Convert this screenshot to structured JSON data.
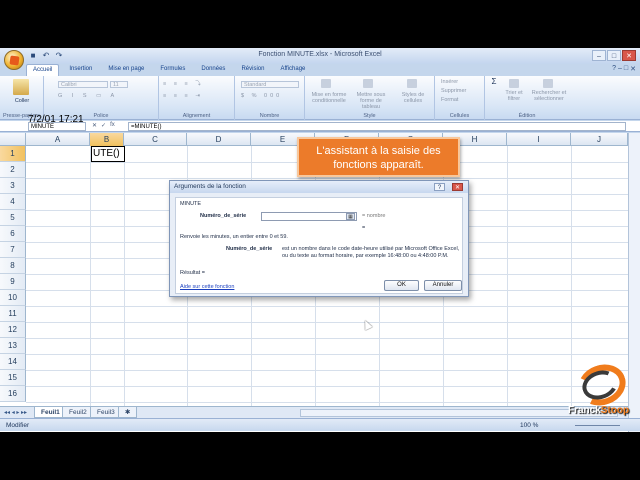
{
  "window": {
    "title": "Fonction MINUTE.xlsx - Microsoft Excel"
  },
  "ribbon": {
    "tabs": [
      "Accueil",
      "Insertion",
      "Mise en page",
      "Formules",
      "Données",
      "Révision",
      "Affichage"
    ],
    "active_tab": "Accueil",
    "groups": {
      "clipboard": {
        "label": "Presse-papiers",
        "paste": "Coller"
      },
      "font": {
        "label": "Police",
        "font_name": "Calibri",
        "font_size": "11"
      },
      "alignment": {
        "label": "Alignement"
      },
      "number": {
        "label": "Nombre",
        "format": "Standard"
      },
      "style": {
        "label": "Style",
        "cond_format": "Mise en forme conditionnelle",
        "table_format": "Mettre sous forme de tableau",
        "cell_styles": "Styles de cellules"
      },
      "cells": {
        "label": "Cellules",
        "insert": "Insérer",
        "delete": "Supprimer",
        "format": "Format"
      },
      "editing": {
        "label": "Édition",
        "sort": "Trier et filtrer",
        "find": "Rechercher et sélectionner"
      }
    }
  },
  "formula_bar": {
    "name_box": "MINUTE",
    "fx": "fx",
    "formula": "=MINUTE()"
  },
  "grid": {
    "columns": [
      "A",
      "B",
      "C",
      "D",
      "E",
      "F",
      "G",
      "H",
      "I",
      "J"
    ],
    "rows": [
      "1",
      "2",
      "3",
      "4",
      "5",
      "6",
      "7",
      "8",
      "9",
      "10",
      "11",
      "12",
      "13",
      "14",
      "15",
      "16"
    ],
    "cells": {
      "A1": "7/2/01 17:21",
      "B1": "UTE()"
    }
  },
  "sheets": [
    "Feuil1",
    "Feuil2",
    "Feuil3"
  ],
  "active_sheet": "Feuil1",
  "status": {
    "mode": "Modifier",
    "zoom": "100 %"
  },
  "callout": {
    "text": "L'assistant à la saisie des fonctions apparaît."
  },
  "dialog": {
    "title": "Arguments de la fonction",
    "function_name": "MINUTE",
    "arg_label": "Numéro_de_série",
    "arg_value": "",
    "arg_result": "= nombre",
    "result_eq": "=",
    "description": "Renvoie les minutes, un entier entre 0 et 59.",
    "arg_help_label": "Numéro_de_série",
    "arg_help_text": "est un nombre dans le code date-heure utilisé par Microsoft Office Excel, ou du texte au format horaire, par exemple 16:48:00 ou 4:48:00 P.M.",
    "result_label": "Résultat =",
    "help_link": "Aide sur cette fonction",
    "ok": "OK",
    "cancel": "Annuler"
  },
  "logo": {
    "part1": "Franck",
    "part2": "Stoop"
  }
}
